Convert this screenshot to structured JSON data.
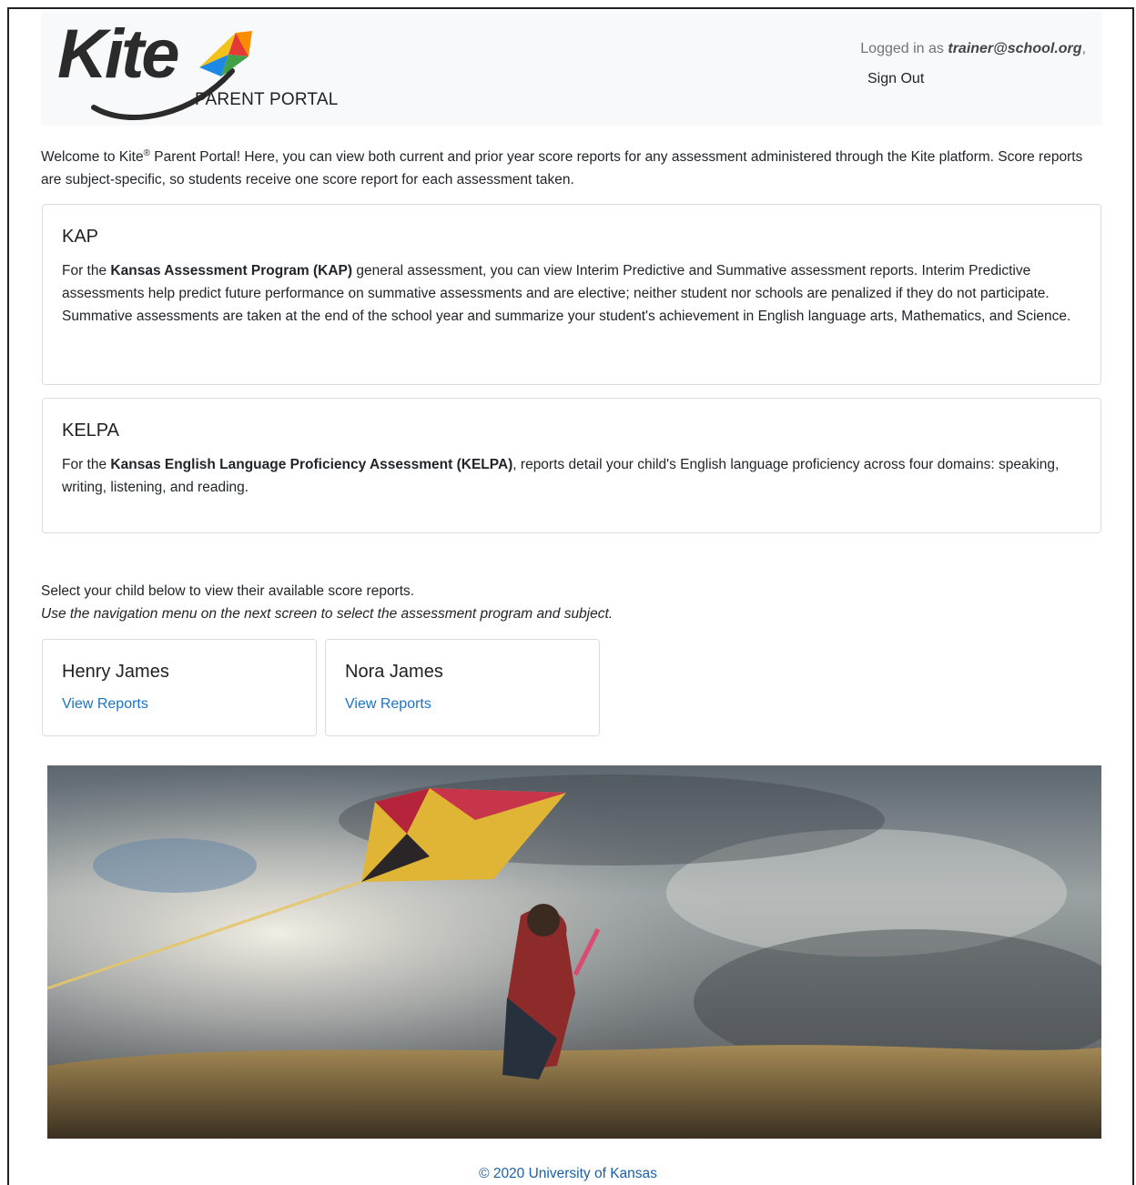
{
  "header": {
    "logo_word": "Kite",
    "logo_subtitle": "PARENT PORTAL",
    "logged_in_prefix": "Logged in as",
    "user_email": "trainer@school.org",
    "sign_out_label": "Sign Out"
  },
  "intro": {
    "part1": "Welcome to Kite",
    "registered": "®",
    "part2": " Parent Portal! Here, you can view both current and prior year score reports for any assessment administered through the Kite platform. Score reports are subject-specific, so students receive one score report for each assessment taken."
  },
  "programs": [
    {
      "title": "KAP",
      "text_before": "For the ",
      "bold_name": "Kansas Assessment Program (KAP)",
      "text_after": " general assessment, you can view Interim Predictive and Summative assessment reports. Interim Predictive assessments help predict future performance on summative assessments and are elective; neither student nor schools are penalized if they do not participate. Summative assessments are taken at the end of the school year and summarize your student's achievement in English language arts, Mathematics, and Science."
    },
    {
      "title": "KELPA",
      "text_before": "For the ",
      "bold_name": "Kansas English Language Proficiency Assessment (KELPA)",
      "text_after": ", reports detail your child's English language proficiency across four domains: speaking, writing, listening, and reading."
    }
  ],
  "select": {
    "line1": "Select your child below to view their available score reports.",
    "line2": "Use the navigation menu on the next screen to select the assessment program and subject."
  },
  "children": [
    {
      "name": "Henry James",
      "link": "View Reports"
    },
    {
      "name": "Nora James",
      "link": "View Reports"
    }
  ],
  "footer": {
    "text": "© 2020 University of Kansas"
  },
  "colors": {
    "link": "#1a73c9",
    "header_bg": "#f8f9fa",
    "card_border": "#dcdcdc"
  }
}
